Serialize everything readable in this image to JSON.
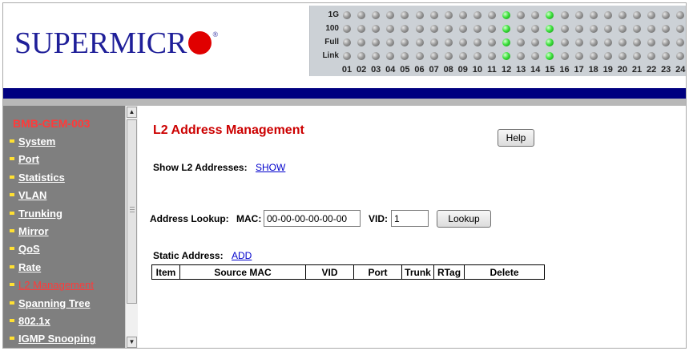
{
  "brand": {
    "name": "SUPERMICR",
    "registered": "®"
  },
  "port_panel": {
    "row_labels": [
      "1G",
      "100",
      "Full",
      "Link"
    ],
    "port_numbers": [
      "01",
      "02",
      "03",
      "04",
      "05",
      "06",
      "07",
      "08",
      "09",
      "10",
      "11",
      "12",
      "13",
      "14",
      "15",
      "16",
      "17",
      "18",
      "19",
      "20",
      "21",
      "22",
      "23",
      "24"
    ],
    "active_ports": {
      "1G": [
        12,
        15
      ],
      "100": [
        12,
        15
      ],
      "Full": [
        12,
        15
      ],
      "Link": [
        12,
        15
      ]
    },
    "led_colors": {
      "on": "#3ee23e",
      "off": "#8a8a8a"
    }
  },
  "sidebar": {
    "device_name": "BMB-GEM-003",
    "items": [
      {
        "label": "System",
        "active": false
      },
      {
        "label": "Port",
        "active": false
      },
      {
        "label": "Statistics",
        "active": false
      },
      {
        "label": "VLAN",
        "active": false
      },
      {
        "label": "Trunking",
        "active": false
      },
      {
        "label": "Mirror",
        "active": false
      },
      {
        "label": "QoS",
        "active": false
      },
      {
        "label": "Rate",
        "active": false
      },
      {
        "label": "L2 Management",
        "active": true
      },
      {
        "label": "Spanning Tree",
        "active": false
      },
      {
        "label": "802.1x",
        "active": false
      },
      {
        "label": "IGMP Snooping",
        "active": false
      }
    ]
  },
  "main": {
    "title": "L2 Address Management",
    "help_label": "Help",
    "show_label": "Show L2 Addresses:",
    "show_link": "SHOW",
    "lookup": {
      "label": "Address Lookup:",
      "mac_label": "MAC:",
      "mac_value": "00-00-00-00-00-00",
      "vid_label": "VID:",
      "vid_value": "1",
      "button": "Lookup"
    },
    "static_label": "Static Address:",
    "static_link": "ADD",
    "table_headers": [
      "Item",
      "Source MAC",
      "VID",
      "Port",
      "Trunk",
      "RTag",
      "Delete"
    ]
  },
  "colors": {
    "brand_blue": "#1f1f99",
    "brand_red": "#e00000",
    "title_red": "#cc0000",
    "nav_bar": "#000080",
    "sidebar_bg": "#7f7f7f"
  }
}
